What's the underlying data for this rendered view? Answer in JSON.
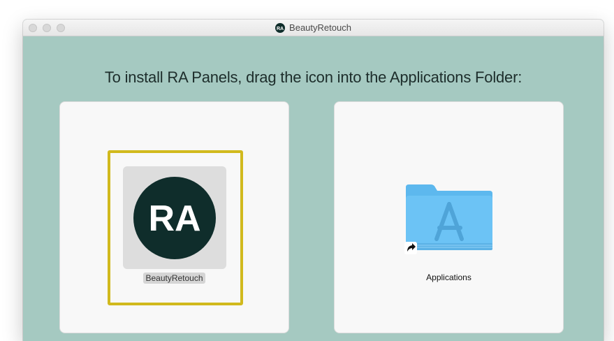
{
  "window": {
    "title": "BeautyRetouch",
    "logo_text": "RA"
  },
  "installer": {
    "instruction": "To install RA Panels, drag the icon into the Applications Folder:"
  },
  "app": {
    "icon_text": "RA",
    "label": "BeautyRetouch"
  },
  "folder": {
    "label": "Applications"
  },
  "colors": {
    "background": "#a5c9c1",
    "highlight": "#d1b91d",
    "logo_circle": "#0f2d2b",
    "folder": "#6cc3f5"
  },
  "icons": {
    "app": "ra-logo-icon",
    "folder": "applications-folder-icon",
    "alias": "alias-arrow-icon"
  }
}
